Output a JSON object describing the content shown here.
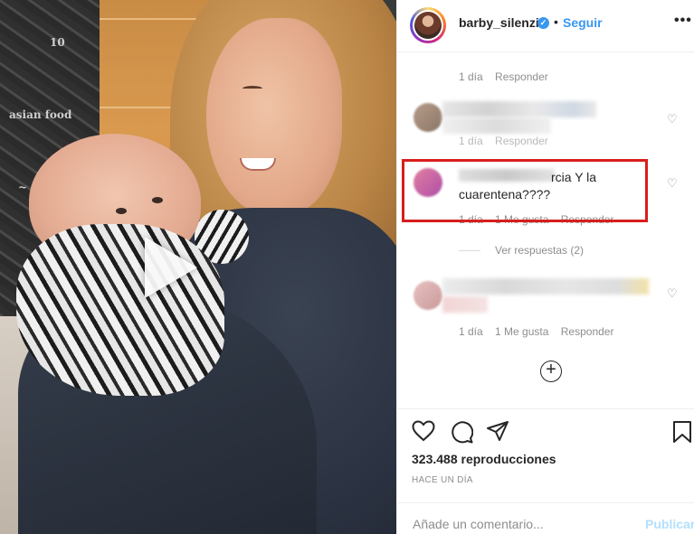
{
  "header": {
    "username": "barby_silenzi",
    "verified_glyph": "✓",
    "separator": "•",
    "follow_label": "Seguir",
    "more_glyph": "•••"
  },
  "comments": [
    {
      "meta": {
        "time": "1 día",
        "reply": "Responder"
      }
    },
    {
      "meta": {
        "time": "1 día",
        "reply": "Responder"
      }
    },
    {
      "text_visible": "rcia Y la",
      "text_line2": "cuarentena????",
      "meta": {
        "time": "1 día",
        "likes": "1 Me gusta",
        "reply": "Responder"
      }
    },
    {
      "meta": {
        "time": "1 día",
        "likes": "1 Me gusta",
        "reply": "Responder"
      }
    }
  ],
  "replies": {
    "label": "Ver respuestas (2)"
  },
  "load_more_glyph": "+",
  "footer": {
    "views": "323.488 reproducciones",
    "time_ago": "HACE UN DÍA",
    "comment_placeholder": "Añade un comentario...",
    "publish_label": "Publicar"
  },
  "icons": {
    "heart": "heart-icon",
    "comment": "comment-icon",
    "share": "share-icon",
    "bookmark": "bookmark-icon"
  },
  "colors": {
    "link_blue": "#3897f0",
    "highlight_red": "#d81e1e",
    "muted": "#8e8e8e"
  }
}
